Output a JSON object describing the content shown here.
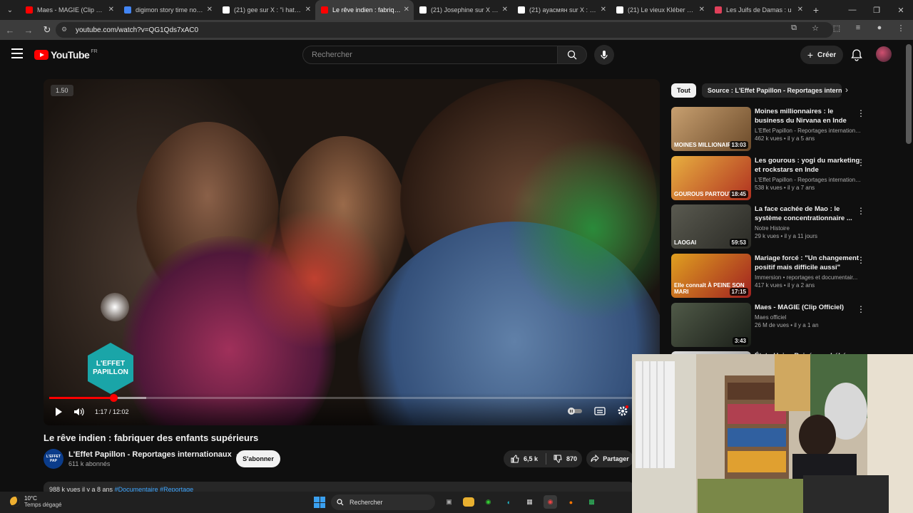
{
  "browser": {
    "tabs": [
      {
        "title": "Maes - MAGIE (Clip Offici",
        "color": "#ff0000",
        "active": false
      },
      {
        "title": "digimon story time note j",
        "color": "#4285f4",
        "active": false
      },
      {
        "title": "(21) gee sur X : \"i hate the",
        "color": "#ffffff",
        "active": false
      },
      {
        "title": "Le rêve indien : fabriquer",
        "color": "#ff0000",
        "active": true
      },
      {
        "title": "(21) Josephine sur X : \"No",
        "color": "#ffffff",
        "active": false
      },
      {
        "title": "(21) аyасмян sur X : \"@Sr",
        "color": "#ffffff",
        "active": false
      },
      {
        "title": "(21) Le vieux Kléber sur X",
        "color": "#ffffff",
        "active": false
      },
      {
        "title": "Les Juifs de Damas : u",
        "color": "#e0405a",
        "active": false
      }
    ],
    "url": "youtube.com/watch?v=QG1Qds7xAC0"
  },
  "youtube": {
    "logo_text": "YouTube",
    "country_code": "FR",
    "search_placeholder": "Rechercher",
    "create_label": "Créer"
  },
  "video": {
    "speed_badge": "1.50",
    "brand_line1": "L'EFFET",
    "brand_line2": "PAPILLON",
    "time": "1:17 / 12:02",
    "progress_fraction": 0.106,
    "buffered_fraction": 0.16,
    "title": "Le rêve indien : fabriquer des enfants supérieurs",
    "channel": "L'Effet Papillon - Reportages internationaux",
    "channel_logo": "L'EFFET PAP",
    "subscribers": "611 k abonnés",
    "subscribe_label": "S'abonner",
    "likes": "6,5 k",
    "dislikes": "870",
    "share_label": "Partager",
    "desc_meta": "988 k vues  il y a 8 ans ",
    "desc_tags": "#Documentaire #Reportage"
  },
  "chips": {
    "all": "Tout",
    "source": "Source : L'Effet Papillon - Reportages internationaux"
  },
  "recommendations": [
    {
      "title": "Moines millionnaires : le business du Nirvana en Inde",
      "channel": "L'Effet Papillon - Reportages internationaux",
      "meta": "462 k vues • il y a 5 ans",
      "duration": "13:03",
      "caption": "MOINES MILLIONAIRES",
      "colors": [
        "#c8a070",
        "#6b4a2a"
      ]
    },
    {
      "title": "Les gourous : yogi du marketing et rockstars en Inde",
      "channel": "L'Effet Papillon - Reportages internationaux",
      "meta": "538 k vues • il y a 7 ans",
      "duration": "18:45",
      "caption": "GOUROUS PARTOUT",
      "colors": [
        "#e8b040",
        "#b03020"
      ]
    },
    {
      "title": "La face cachée de Mao : le système concentrationnaire ...",
      "channel": "Notre Histoire",
      "meta": "29 k vues • il y a 11 jours",
      "duration": "59:53",
      "caption": "LAOGAI",
      "colors": [
        "#5a5a50",
        "#2a2a25"
      ]
    },
    {
      "title": "Mariage forcé : \"Un changement positif mais difficile aussi\"",
      "channel": "Immersion • reportages et documentair...",
      "meta": "417 k vues • il y a 2 ans",
      "duration": "17:15",
      "caption": "Elle connaît À PEINE SON MARI",
      "colors": [
        "#e0a020",
        "#a02020"
      ]
    },
    {
      "title": "Maes - MAGIE (Clip Officiel)",
      "channel": "Maes officiel",
      "meta": "26 M de vues • il y a 1 an",
      "duration": "3:43",
      "caption": "",
      "colors": [
        "#505a48",
        "#1a1e18"
      ]
    },
    {
      "title": "États-Unis : Bajaés par bébé",
      "channel": "",
      "meta": "",
      "duration": "",
      "caption": "",
      "colors": [
        "#ddd",
        "#999"
      ]
    }
  ],
  "taskbar": {
    "temp": "10°C",
    "weather": "Temps dégagé",
    "search_label": "Rechercher"
  }
}
